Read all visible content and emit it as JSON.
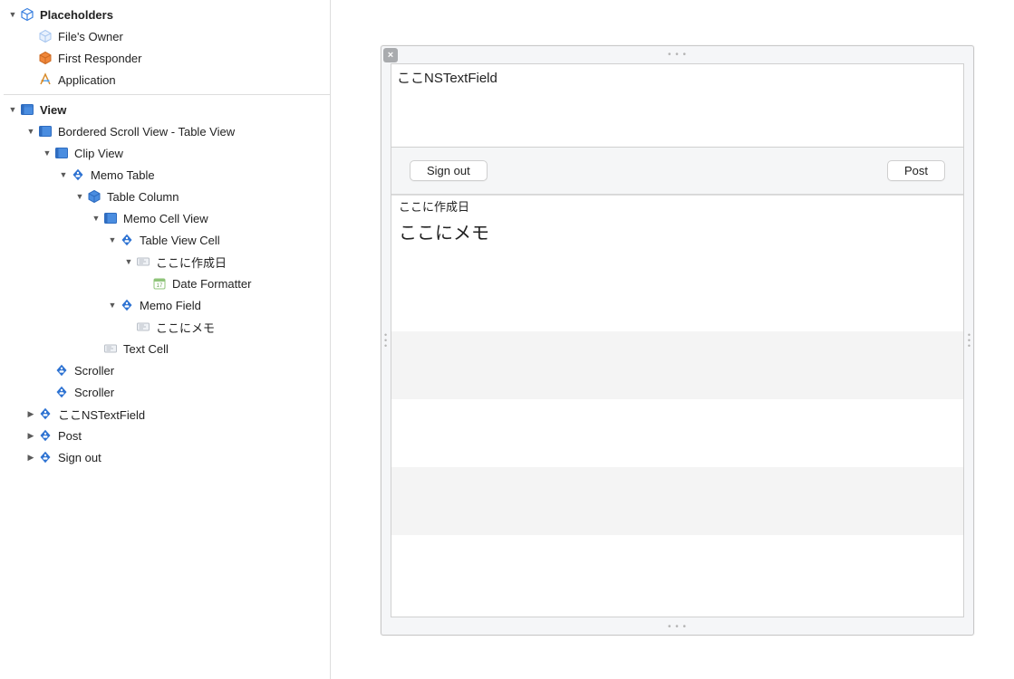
{
  "outline": {
    "placeholders_header": "Placeholders",
    "files_owner": "File's Owner",
    "first_responder": "First Responder",
    "application": "Application",
    "view": "View",
    "bordered_scroll_view": "Bordered Scroll View - Table View",
    "clip_view": "Clip View",
    "memo_table": "Memo Table",
    "table_column": "Table Column",
    "memo_cell_view": "Memo Cell View",
    "table_view_cell": "Table View Cell",
    "created_label_cell": "ここに作成日",
    "date_formatter": "Date Formatter",
    "memo_field": "Memo Field",
    "memo_cell_text": "ここにメモ",
    "text_cell": "Text Cell",
    "scroller1": "Scroller",
    "scroller2": "Scroller",
    "ns_text_field": "ここNSTextField",
    "post_item": "Post",
    "sign_out_item": "Sign out"
  },
  "canvas": {
    "text_field_value": "ここNSTextField",
    "sign_out_btn": "Sign out",
    "post_btn": "Post",
    "row_date": "ここに作成日",
    "row_memo": "ここにメモ"
  }
}
